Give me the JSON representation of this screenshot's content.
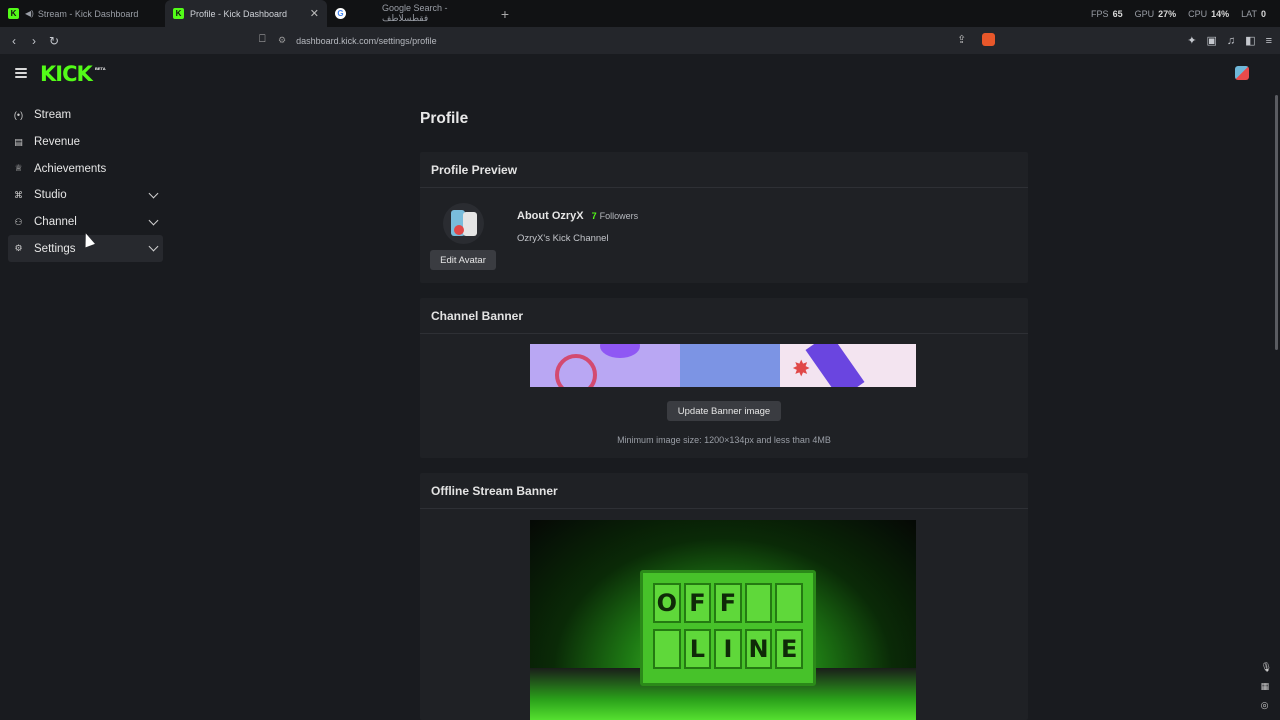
{
  "browser": {
    "tabs": [
      {
        "title": "Stream - Kick Dashboard",
        "favicon": "K"
      },
      {
        "title": "Profile - Kick Dashboard",
        "favicon": "K"
      },
      {
        "title": "Google Search - فقطسلاطف"
      }
    ],
    "stats": {
      "fps_label": "FPS",
      "fps": "65",
      "gpu_label": "GPU",
      "gpu": "27%",
      "cpu_label": "CPU",
      "cpu": "14%",
      "lat_label": "LAT",
      "lat": "0"
    },
    "url": "dashboard.kick.com/settings/profile"
  },
  "app": {
    "logo": "KICK",
    "logo_badge": "BETA"
  },
  "sidebar": {
    "items": [
      {
        "label": "Stream",
        "icon": "broadcast-icon"
      },
      {
        "label": "Revenue",
        "icon": "wallet-icon"
      },
      {
        "label": "Achievements",
        "icon": "trophy-icon"
      },
      {
        "label": "Studio",
        "icon": "studio-icon"
      },
      {
        "label": "Channel",
        "icon": "channel-icon"
      },
      {
        "label": "Settings",
        "icon": "gear-icon"
      }
    ]
  },
  "main": {
    "title": "Profile",
    "profile_preview": {
      "heading": "Profile Preview",
      "about": "About OzryX",
      "followers_count": "7",
      "followers_label": "Followers",
      "bio": "OzryX's Kick Channel",
      "edit_avatar_label": "Edit Avatar"
    },
    "channel_banner": {
      "heading": "Channel Banner",
      "update_label": "Update Banner image",
      "hint": "Minimum image size: 1200×134px and less than 4MB"
    },
    "offline_banner": {
      "heading": "Offline Stream Banner",
      "sign_row1": [
        "O",
        "F",
        "F",
        ""
      ],
      "sign_row2": [
        "",
        "L",
        "I",
        "N",
        "E"
      ]
    }
  },
  "colors": {
    "brand": "#53fc18",
    "background": "#191b1f",
    "card": "#1f2125"
  }
}
